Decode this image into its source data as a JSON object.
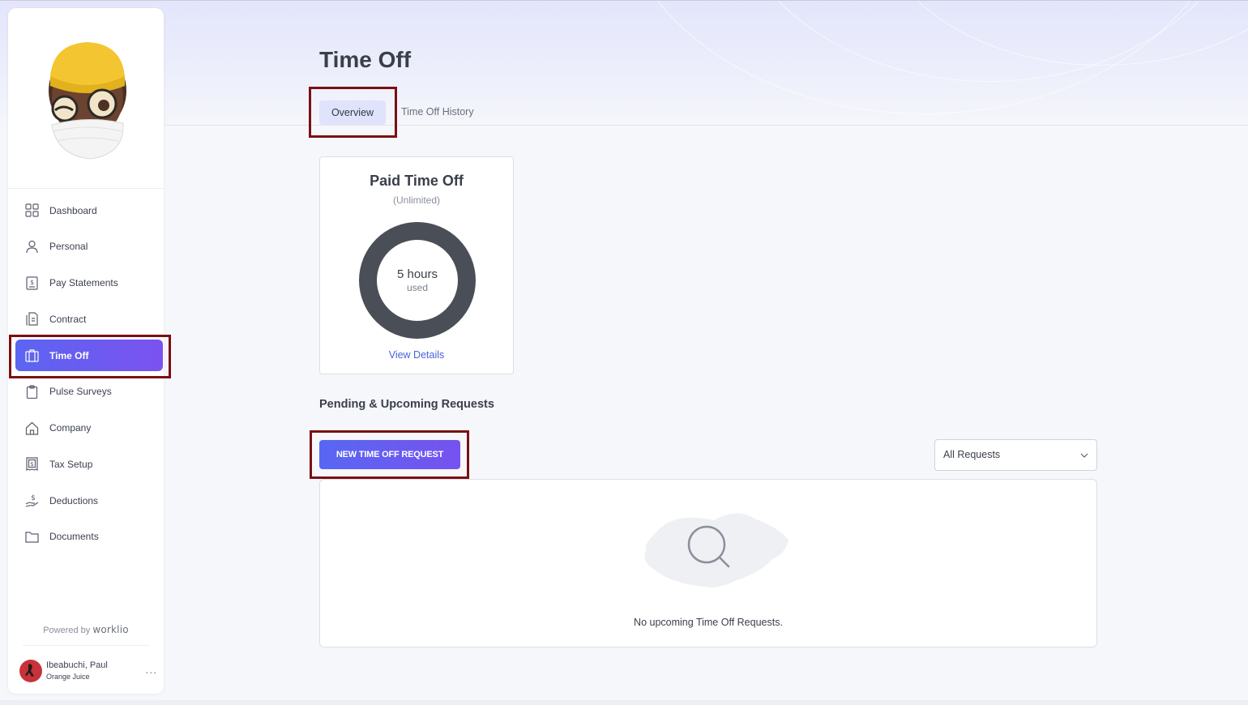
{
  "page": {
    "title": "Time Off",
    "tabs": [
      "Overview",
      "Time Off History"
    ]
  },
  "sidebar": {
    "items": [
      {
        "label": "Dashboard",
        "icon": "grid-icon"
      },
      {
        "label": "Personal",
        "icon": "person-icon"
      },
      {
        "label": "Pay Statements",
        "icon": "dollar-doc-icon"
      },
      {
        "label": "Contract",
        "icon": "contract-icon"
      },
      {
        "label": "Time Off",
        "icon": "suitcase-icon"
      },
      {
        "label": "Pulse Surveys",
        "icon": "clipboard-icon"
      },
      {
        "label": "Company",
        "icon": "home-icon"
      },
      {
        "label": "Tax Setup",
        "icon": "tax-receipt-icon"
      },
      {
        "label": "Deductions",
        "icon": "hand-dollar-icon"
      },
      {
        "label": "Documents",
        "icon": "folder-icon"
      }
    ],
    "active_item": "Time Off",
    "powered_by": "Powered by",
    "brand": "worklio",
    "user": {
      "name": "Ibeabuchi, Paul",
      "org": "Orange Juice",
      "menu": "..."
    }
  },
  "pto": {
    "title": "Paid Time Off",
    "subtitle": "(Unlimited)",
    "used_value": "5 hours",
    "used_label": "used",
    "link": "View Details"
  },
  "requests": {
    "section_title": "Pending & Upcoming Requests",
    "new_button": "NEW TIME OFF REQUEST",
    "filter_selected": "All Requests",
    "empty_text": "No upcoming Time Off Requests."
  },
  "colors": {
    "accent_start": "#5867f3",
    "accent_end": "#7652ef",
    "highlight": "#7a0f14",
    "link": "#4a63d9",
    "donut": "#4a4f57"
  }
}
